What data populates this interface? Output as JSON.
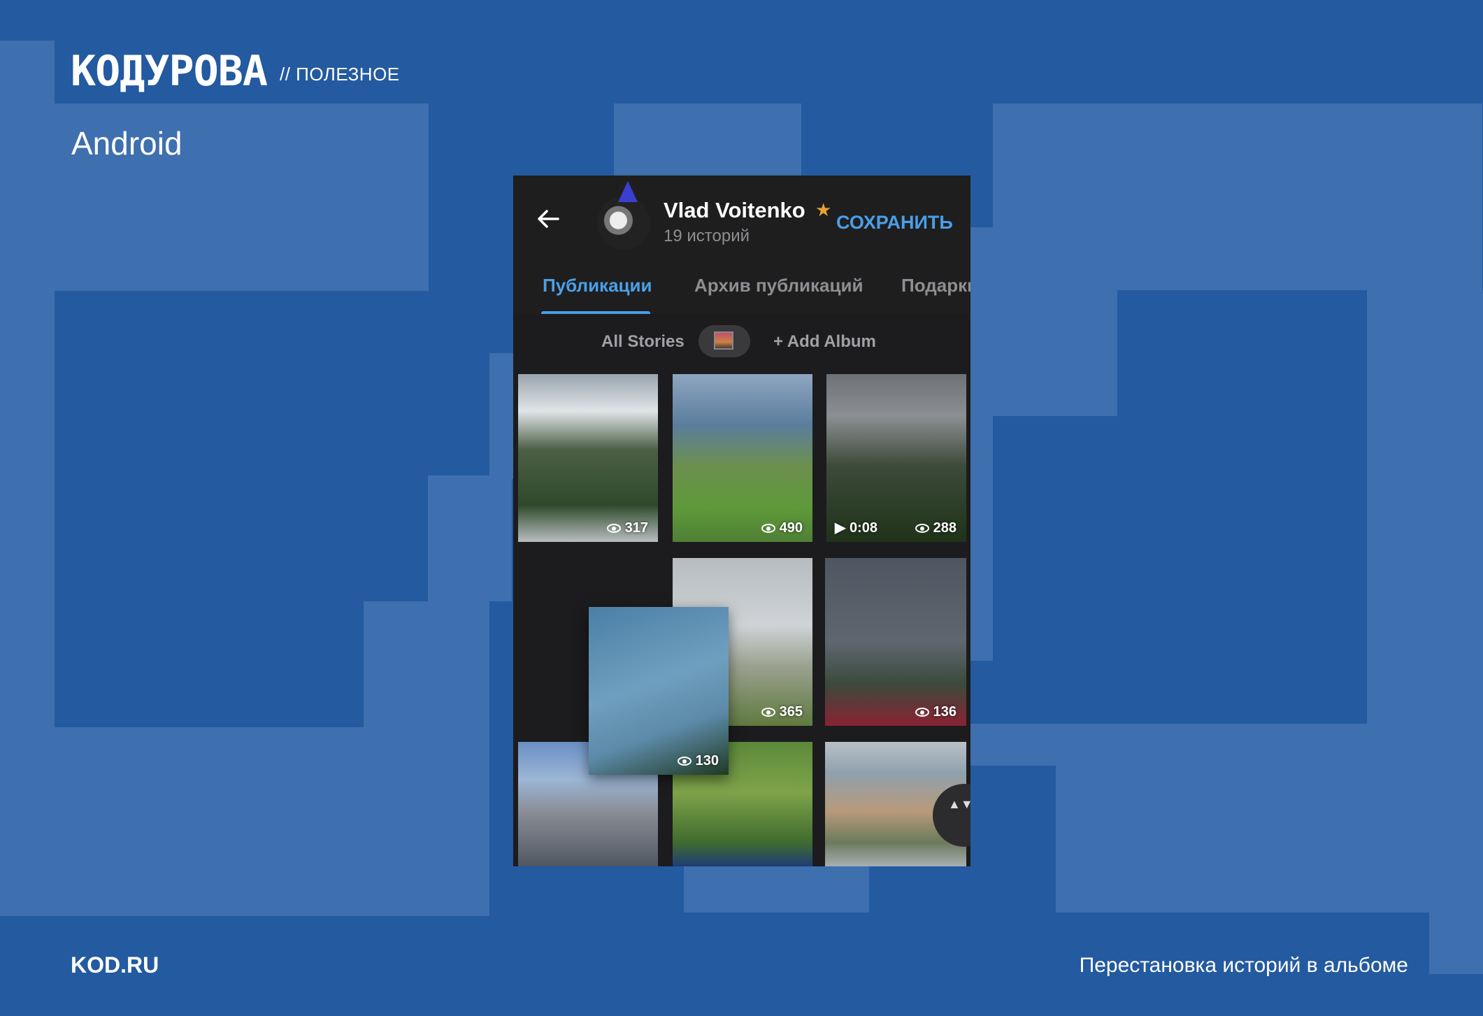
{
  "brand": {
    "logo": "КОДУРОВА",
    "section": "// ПОЛЕЗНОЕ"
  },
  "platform": "Android",
  "footer": {
    "site": "KOD.RU",
    "caption": "Перестановка историй в альбоме"
  },
  "app": {
    "header": {
      "name": "Vlad Voitenko",
      "subtitle": "19 историй",
      "save_label": "СОХРАНИТЬ"
    },
    "tabs": [
      {
        "label": "Публикации",
        "active": true
      },
      {
        "label": "Архив публикаций",
        "active": false
      },
      {
        "label": "Подарки",
        "active": false
      }
    ],
    "albums": {
      "all_label": "All Stories",
      "add_label": "+ Add Album"
    },
    "tiles": [
      {
        "views": "317"
      },
      {
        "views": "490"
      },
      {
        "duration": "▶ 0:08",
        "views": "288"
      },
      {
        "views": "365"
      },
      {
        "views": "136"
      },
      {
        "views": "130"
      }
    ],
    "fab_icon": "▲▼"
  },
  "colors": {
    "background": "#235aa0",
    "panel": "#1c1c1e",
    "accent": "#4a9fe8"
  }
}
